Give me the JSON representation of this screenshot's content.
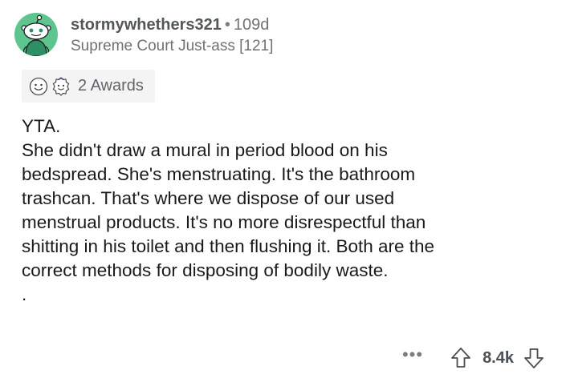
{
  "comment": {
    "username": "stormywhethers321",
    "separator": "•",
    "age": "109d",
    "flair": "Supreme Court Just-ass [121]",
    "awards": {
      "count_label": "2 Awards",
      "icons": [
        "smiley-award-icon",
        "wholesome-seal-award-icon"
      ]
    },
    "body": {
      "p1": "YTA.",
      "p2": "She didn't draw a mural in period blood on his\nbedspread.  She's menstruating. It's the bathroom\ntrashcan. That's where we dispose of our used\nmenstrual products. It's no more disrespectful than\nshitting in his toilet and then flushing it. Both are the\ncorrect methods for disposing of bodily waste.",
      "p3": "."
    },
    "actions": {
      "more_label": "•••",
      "score": "8.4k",
      "upvote_icon": "upvote-arrow-icon",
      "downvote_icon": "downvote-arrow-icon"
    }
  },
  "colors": {
    "avatar_bg": "#5fc58e",
    "awards_bg": "#f4f4f4",
    "text": "#1a1a1b",
    "meta": "#6e7275"
  }
}
